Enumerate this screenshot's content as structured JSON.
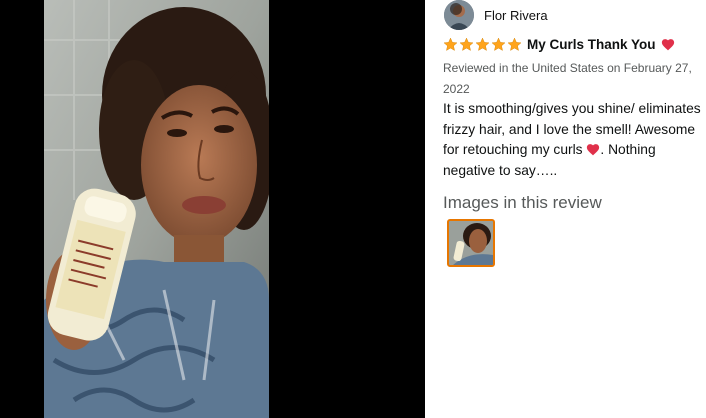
{
  "reviewer": {
    "name": "Flor Rivera",
    "avatar": "avatar-photo"
  },
  "review": {
    "rating": 5,
    "rating_max": 5,
    "title": "My Curls Thank You",
    "title_icon": "heart-icon",
    "date": "Reviewed in the United States on February 27, 2022",
    "body_before": "It is smoothing/gives you shine/ eliminates frizzy hair, and I love the smell! Awesome for retouching my curls",
    "body_after": ". Nothing negative to say…..",
    "colors": {
      "star": "#ffa41c",
      "heart": "#e0304a"
    }
  },
  "gallery": {
    "heading": "Images in this review",
    "thumbnails": [
      "review-photo-thumbnail"
    ],
    "selected_color": "#e77600"
  },
  "viewer": {
    "image": "selfie-with-product-bottle"
  }
}
